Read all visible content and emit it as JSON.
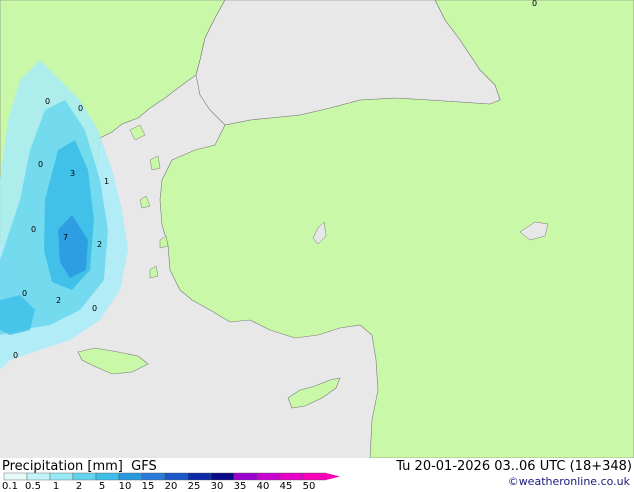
{
  "map": {
    "labels": [
      {
        "text": "0"
      },
      {
        "text": "0"
      },
      {
        "text": "0"
      },
      {
        "text": "3"
      },
      {
        "text": "1"
      },
      {
        "text": "0"
      },
      {
        "text": "7"
      },
      {
        "text": "2"
      },
      {
        "text": "0"
      },
      {
        "text": "2"
      },
      {
        "text": "0"
      },
      {
        "text": "0"
      },
      {
        "text": "0"
      }
    ]
  },
  "footer": {
    "title": "Precipitation [mm]  GFS",
    "datetime": "Tu 20-01-2026 03..06 UTC (18+348)",
    "credit": "©weatheronline.co.uk"
  },
  "legend": {
    "ticks": [
      "0.1",
      "0.5",
      "1",
      "2",
      "5",
      "10",
      "15",
      "20",
      "25",
      "30",
      "35",
      "40",
      "45",
      "50"
    ],
    "colors": [
      "#e6fafa",
      "#c0f4f8",
      "#96e8f4",
      "#64d4ee",
      "#3cbee8",
      "#2a9ae0",
      "#2a7ad8",
      "#1a58c8",
      "#0a2aa8",
      "#0a0a88",
      "#9a00d0",
      "#c800d0",
      "#e800c8",
      "#f800b8"
    ]
  },
  "colors": {
    "sea": "#e8e8e8",
    "land": "#c8f8a8",
    "border": "#7a7a7a"
  }
}
